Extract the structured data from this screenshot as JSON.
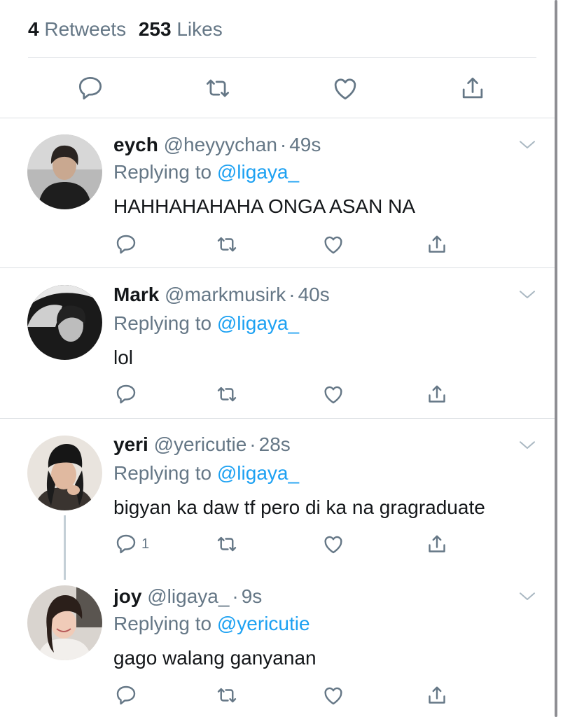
{
  "stats": {
    "retweets_count": "4",
    "retweets_label": "Retweets",
    "likes_count": "253",
    "likes_label": "Likes"
  },
  "main_actions": [
    "reply-icon",
    "retweet-icon",
    "like-icon",
    "share-icon"
  ],
  "replies": [
    {
      "name": "eych",
      "handle": "@heyyychan",
      "dot": "·",
      "time": "49s",
      "replying_prefix": "Replying to",
      "replying_to": "@ligaya_",
      "text": "HAHHAHAHAHA ONGA ASAN NA",
      "reply_count": ""
    },
    {
      "name": "Mark",
      "handle": "@markmusirk",
      "dot": "·",
      "time": "40s",
      "replying_prefix": "Replying to",
      "replying_to": "@ligaya_",
      "text": "lol",
      "reply_count": ""
    },
    {
      "name": "yeri",
      "handle": "@yericutie",
      "dot": "·",
      "time": "28s",
      "replying_prefix": "Replying to",
      "replying_to": "@ligaya_",
      "text": "bigyan ka daw tf pero di ka na gragraduate",
      "reply_count": "1"
    },
    {
      "name": "joy",
      "handle": "@ligaya_",
      "dot": "·",
      "time": "9s",
      "replying_prefix": "Replying to",
      "replying_to": "@yericutie",
      "text": "gago walang ganyanan",
      "reply_count": ""
    }
  ],
  "colors": {
    "text": "#14171a",
    "secondary": "#657786",
    "link": "#1da1f2",
    "divider": "#dbdfe3"
  }
}
